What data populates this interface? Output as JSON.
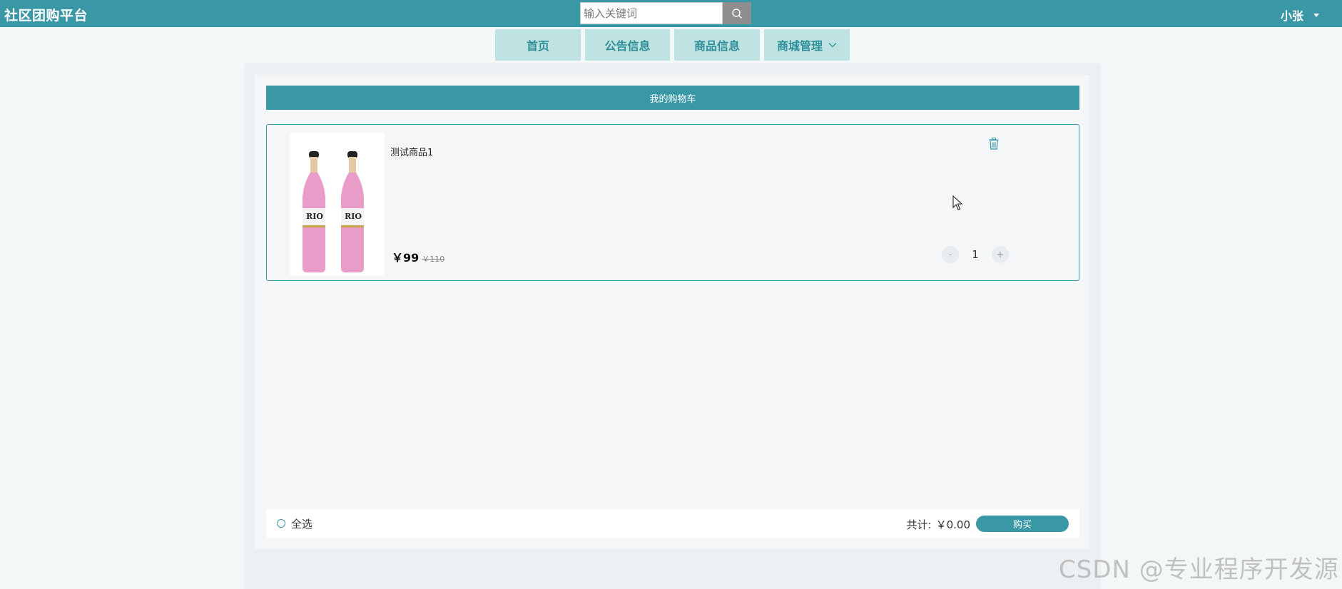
{
  "header": {
    "brand": "社区团购平台",
    "search_placeholder": "输入关键词",
    "search_icon": "search-icon",
    "user_name": "小张"
  },
  "nav": {
    "items": [
      {
        "label": "首页"
      },
      {
        "label": "公告信息"
      },
      {
        "label": "商品信息"
      },
      {
        "label": "商城管理"
      }
    ]
  },
  "cart": {
    "title": "我的购物车",
    "items": [
      {
        "name": "测试商品1",
        "image_label": "RIO",
        "price": "￥99",
        "original_price": "￥110",
        "quantity": "1",
        "minus": "-",
        "plus": "+"
      }
    ],
    "select_all": "全选",
    "total_label": "共计:",
    "total_value": "￥0.00",
    "buy_label": "购买"
  },
  "watermark": "CSDN @专业程序开发源",
  "colors": {
    "primary": "#3a97a6",
    "nav_bg": "#bfe3e3",
    "nav_text": "#2f8f99"
  }
}
